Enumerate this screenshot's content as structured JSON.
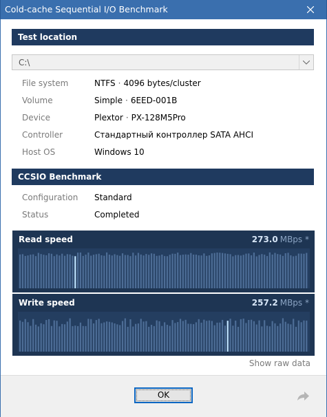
{
  "window": {
    "title": "Cold-cache Sequential I/O Benchmark"
  },
  "sections": {
    "location_header": "Test location",
    "benchmark_header": "CCSIO Benchmark"
  },
  "location_select": {
    "value": "C:\\"
  },
  "info_rows": [
    {
      "label": "File system",
      "parts": [
        "NTFS",
        "4096 bytes/cluster"
      ]
    },
    {
      "label": "Volume",
      "parts": [
        "Simple",
        "6EED-001B"
      ]
    },
    {
      "label": "Device",
      "parts": [
        "Plextor",
        "PX-128M5Pro"
      ]
    },
    {
      "label": "Controller",
      "parts": [
        "Стандартный контроллер SATA AHCI"
      ]
    },
    {
      "label": "Host OS",
      "parts": [
        "Windows 10"
      ]
    }
  ],
  "benchmark_rows": [
    {
      "label": "Configuration",
      "value": "Standard"
    },
    {
      "label": "Status",
      "value": "Completed"
    }
  ],
  "charts": [
    {
      "name": "Read speed",
      "value": "273.0",
      "unit": "MBps *",
      "highlight_index": 21
    },
    {
      "name": "Write speed",
      "value": "257.2",
      "unit": "MBps *",
      "highlight_index": 79
    }
  ],
  "raw_link": "Show raw data",
  "ok_label": "OK",
  "icons": {
    "close": "close-icon",
    "dropdown": "chevron-down-icon",
    "share": "share-arrow-icon"
  },
  "colors": {
    "titlebar": "#3a6fae",
    "header": "#1f3a5f",
    "chart_bg": "#1e3553",
    "bar": "#4d6d96",
    "bar_highlight": "#bfe3ff"
  }
}
